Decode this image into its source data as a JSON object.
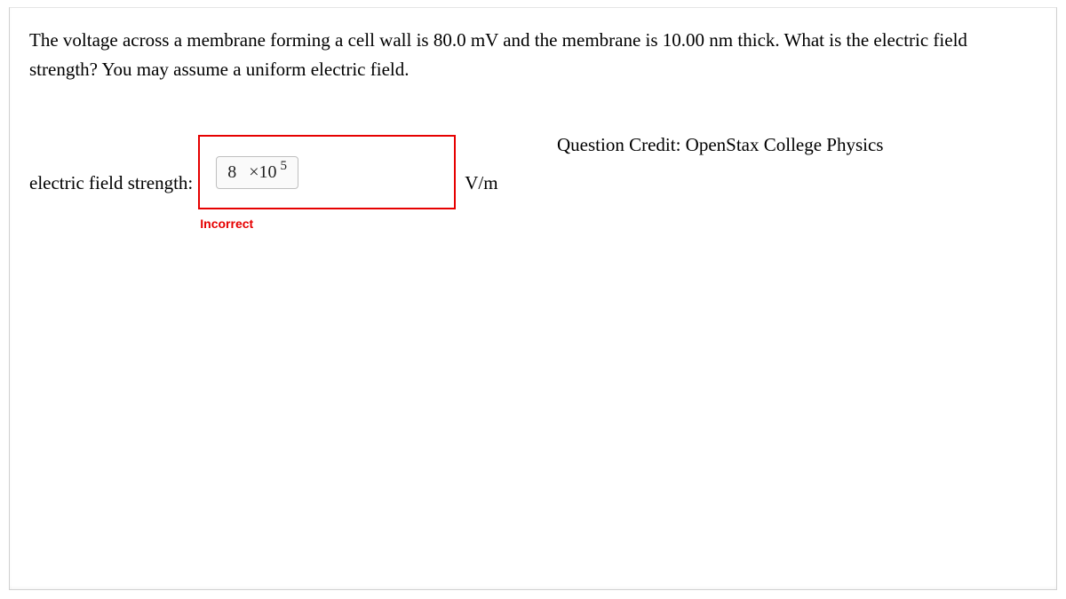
{
  "question": {
    "text": "The voltage across a membrane forming a cell wall is 80.0 mV and the membrane is 10.00 nm thick. What is the electric field strength? You may assume a uniform electric field."
  },
  "credit": "Question Credit: OpenStax College Physics",
  "answer": {
    "label": "electric field strength:",
    "value_coefficient": "8",
    "value_times": "×10",
    "value_exponent": "5",
    "unit": "V/m",
    "feedback": "Incorrect",
    "status_color": "#e60000"
  }
}
